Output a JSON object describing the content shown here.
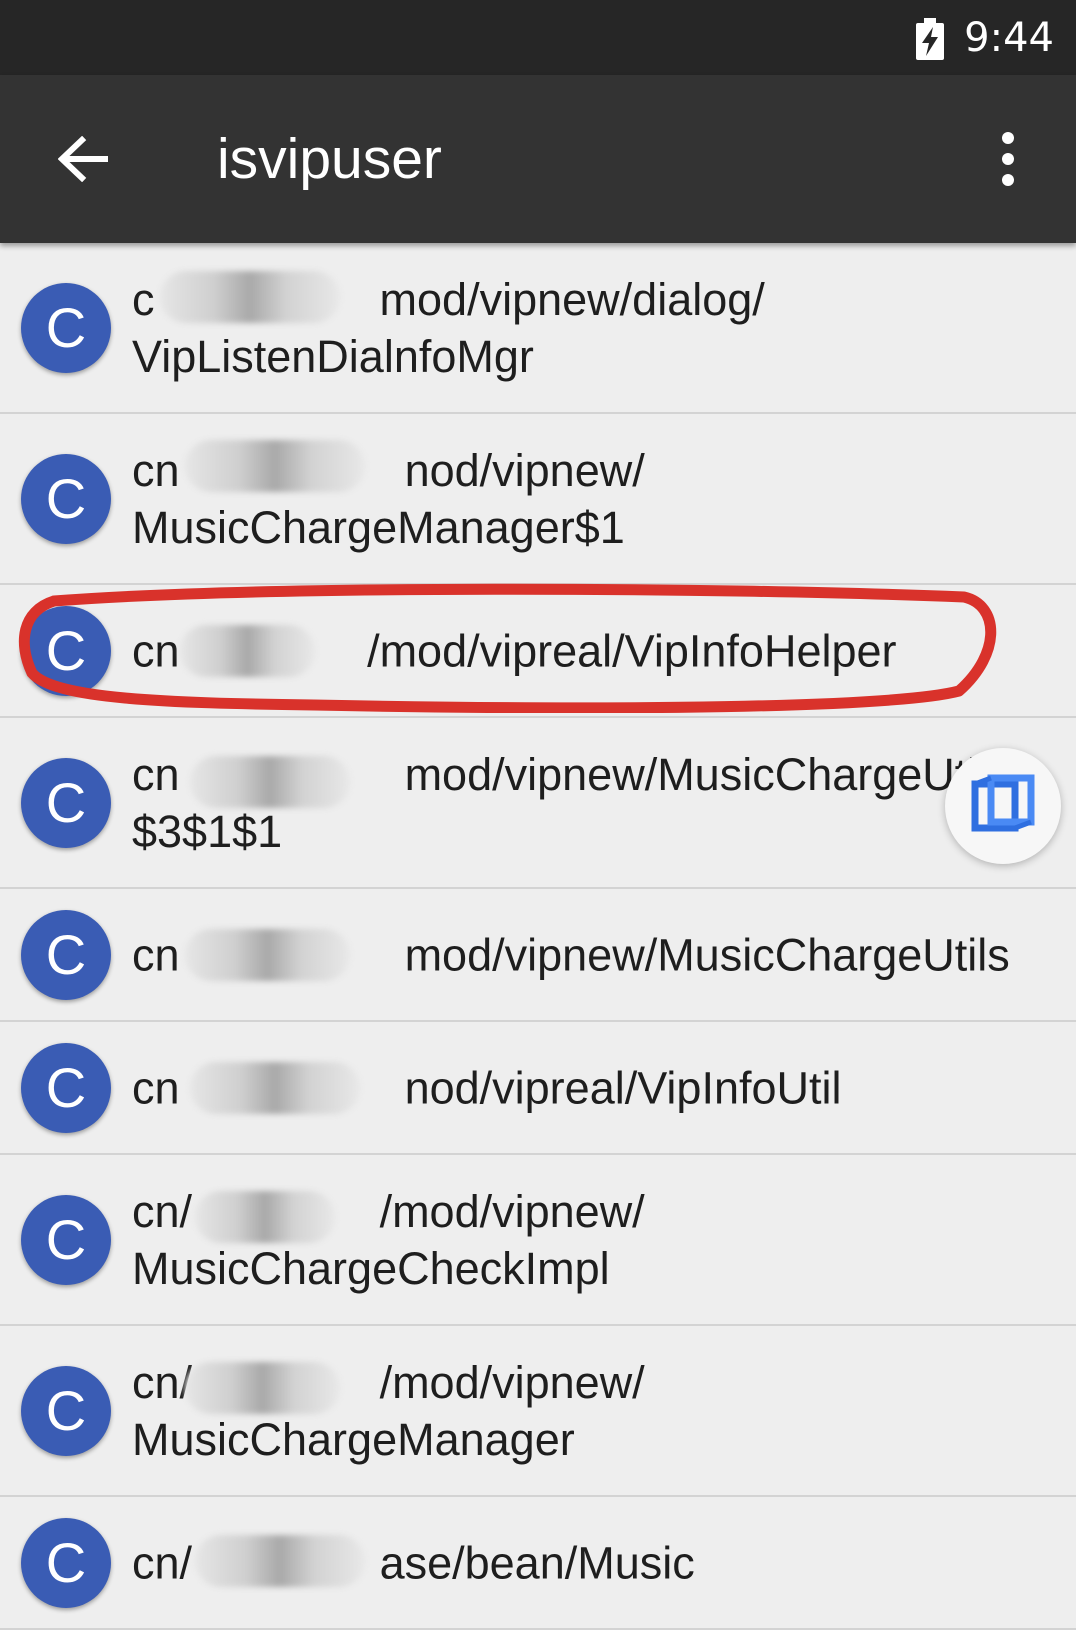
{
  "status_bar": {
    "time": "9:44"
  },
  "app_bar": {
    "title": "isvipuser"
  },
  "results": [
    {
      "avatar_letter": "C",
      "text": "c​                  mod/vipnew/dialog/\nVipListenDialnfoMgr"
    },
    {
      "avatar_letter": "C",
      "text": "cn                  nod/vipnew/\nMusicChargeManager$1"
    },
    {
      "avatar_letter": "C",
      "text": "cn               /mod/vipreal/VipInfoHelper"
    },
    {
      "avatar_letter": "C",
      "text": "cn                  mod/vipnew/MusicChargeUtils\n$3$1$1"
    },
    {
      "avatar_letter": "C",
      "text": "cn                  mod/vipnew/MusicChargeUtils"
    },
    {
      "avatar_letter": "C",
      "text": "cn                  nod/vipreal/VipInfoUtil"
    },
    {
      "avatar_letter": "C",
      "text": "cn/               /mod/vipnew/\nMusicChargeCheckImpl"
    },
    {
      "avatar_letter": "C",
      "text": "cn/               /mod/vipnew/\nMusicChargeManager"
    },
    {
      "avatar_letter": "C",
      "text": "cn/               ase/bean/Music"
    }
  ],
  "colors": {
    "status_bar": "#262626",
    "app_bar": "#333333",
    "list_background": "#eeeeee",
    "avatar": "#3a5cb4",
    "highlight_ring": "#d9322b"
  },
  "icons": {
    "back": "arrow-left-icon",
    "overflow": "more-vertical-icon",
    "battery": "battery-charging-icon",
    "floating": "cube-icon"
  }
}
